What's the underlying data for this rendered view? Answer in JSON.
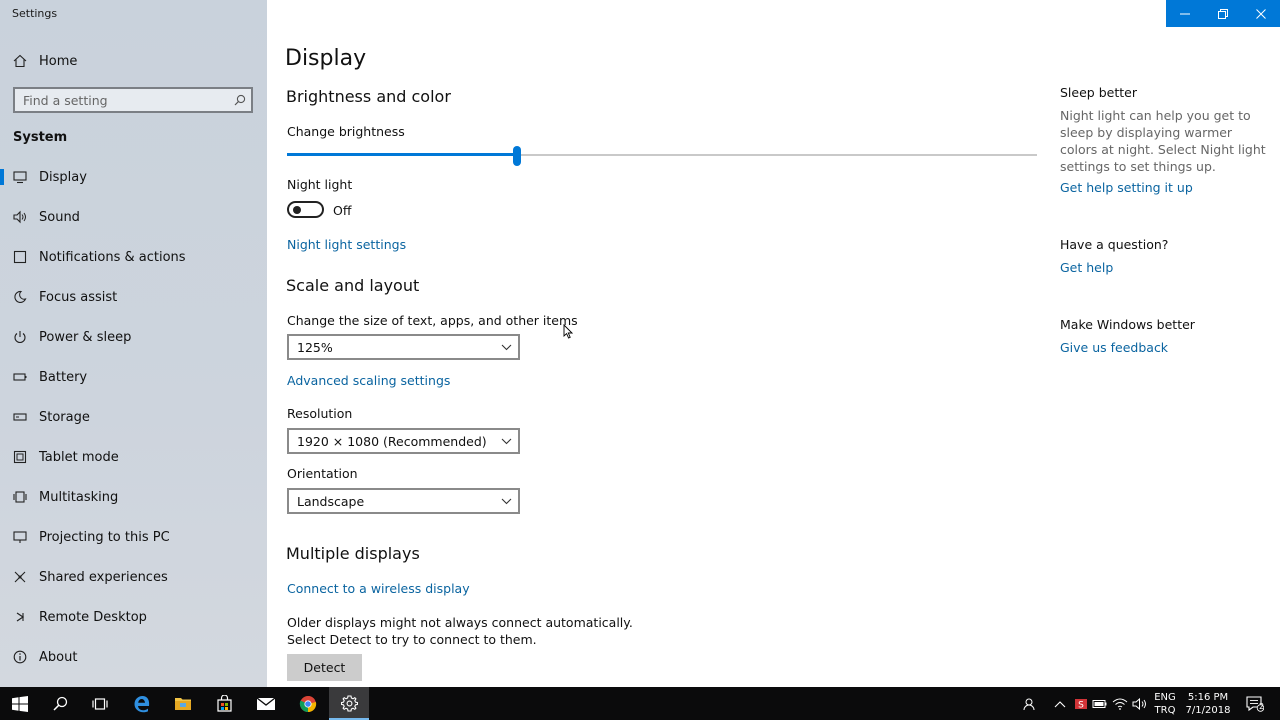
{
  "window": {
    "title": "Settings"
  },
  "sidebar": {
    "home_label": "Home",
    "search_placeholder": "Find a setting",
    "section_label": "System",
    "items": [
      {
        "label": "Display",
        "icon": "monitor-icon"
      },
      {
        "label": "Sound",
        "icon": "speaker-icon"
      },
      {
        "label": "Notifications & actions",
        "icon": "notification-icon"
      },
      {
        "label": "Focus assist",
        "icon": "moon-icon"
      },
      {
        "label": "Power & sleep",
        "icon": "power-icon"
      },
      {
        "label": "Battery",
        "icon": "battery-icon"
      },
      {
        "label": "Storage",
        "icon": "storage-icon"
      },
      {
        "label": "Tablet mode",
        "icon": "tablet-icon"
      },
      {
        "label": "Multitasking",
        "icon": "multitasking-icon"
      },
      {
        "label": "Projecting to this PC",
        "icon": "projecting-icon"
      },
      {
        "label": "Shared experiences",
        "icon": "shared-icon"
      },
      {
        "label": "Remote Desktop",
        "icon": "remote-desktop-icon"
      },
      {
        "label": "About",
        "icon": "info-icon"
      }
    ],
    "selected_index": 0
  },
  "main": {
    "title": "Display",
    "brightness_section": "Brightness and color",
    "brightness_label": "Change brightness",
    "brightness_value": 0.306,
    "night_light_label": "Night light",
    "night_light_state": "Off",
    "night_light_settings_link": "Night light settings",
    "scale_section": "Scale and layout",
    "scale_label": "Change the size of text, apps, and other items",
    "scale_value": "125%",
    "advanced_scaling_link": "Advanced scaling settings",
    "resolution_label": "Resolution",
    "resolution_value": "1920 × 1080 (Recommended)",
    "orientation_label": "Orientation",
    "orientation_value": "Landscape",
    "multiple_displays_section": "Multiple displays",
    "wireless_link": "Connect to a wireless display",
    "older_displays_text": "Older displays might not always connect automatically. Select Detect to try to connect to them.",
    "detect_button": "Detect"
  },
  "right": {
    "sleep_title": "Sleep better",
    "sleep_body": "Night light can help you get to sleep by displaying warmer colors at night. Select Night light settings to set things up.",
    "sleep_link": "Get help setting it up",
    "question_title": "Have a question?",
    "question_link": "Get help",
    "feedback_title": "Make Windows better",
    "feedback_link": "Give us feedback"
  },
  "taskbar": {
    "apps": [
      "start-icon",
      "search-icon",
      "task-view-icon",
      "edge-icon",
      "file-explorer-icon",
      "store-icon",
      "mail-icon",
      "chrome-icon",
      "settings-icon"
    ],
    "lang_top": "ENG",
    "lang_bottom": "TRQ",
    "time": "5:16 PM",
    "date": "7/1/2018",
    "notification_count": "2"
  },
  "colors": {
    "accent": "#0078d7",
    "link": "#0a64a0",
    "taskbar": "#0b0b0c"
  }
}
